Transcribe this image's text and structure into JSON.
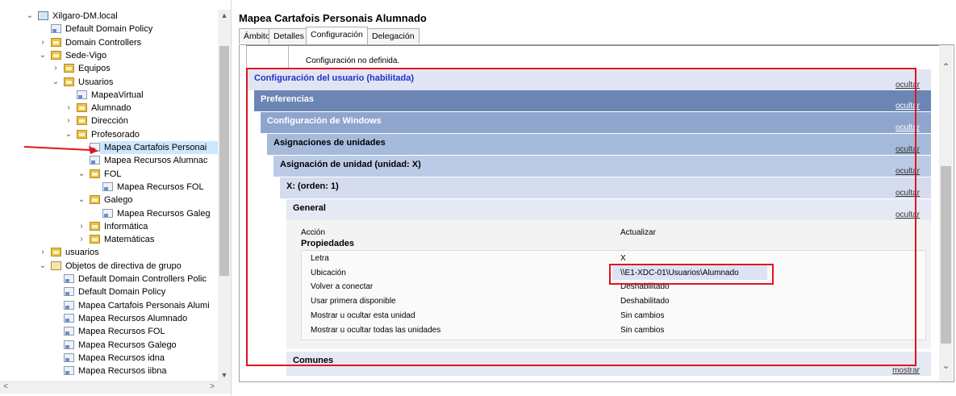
{
  "tree": {
    "items": [
      {
        "label": "Xilgaro-DM.local",
        "icon": "domain",
        "toggle": "expanded"
      },
      {
        "label": "Default Domain Policy",
        "icon": "gpo",
        "toggle": "none"
      },
      {
        "label": "Domain Controllers",
        "icon": "folder",
        "toggle": "collapsed"
      },
      {
        "label": "Sede-Vigo",
        "icon": "folder",
        "toggle": "expanded"
      },
      {
        "label": "Equipos",
        "icon": "folder",
        "toggle": "collapsed"
      },
      {
        "label": "Usuarios",
        "icon": "folder",
        "toggle": "expanded"
      },
      {
        "label": "MapeaVirtual",
        "icon": "gpo",
        "toggle": "none"
      },
      {
        "label": "Alumnado",
        "icon": "folder",
        "toggle": "collapsed"
      },
      {
        "label": "Dirección",
        "icon": "folder",
        "toggle": "collapsed"
      },
      {
        "label": "Profesorado",
        "icon": "folder",
        "toggle": "expanded"
      },
      {
        "label": "Mapea Cartafois Personai",
        "icon": "gpo",
        "toggle": "none",
        "selected": true
      },
      {
        "label": "Mapea Recursos Alumnac",
        "icon": "gpo",
        "toggle": "none"
      },
      {
        "label": "FOL",
        "icon": "folder",
        "toggle": "expanded"
      },
      {
        "label": "Mapea Recursos FOL",
        "icon": "gpo",
        "toggle": "none"
      },
      {
        "label": "Galego",
        "icon": "folder",
        "toggle": "expanded"
      },
      {
        "label": "Mapea Recursos Galeg",
        "icon": "gpo",
        "toggle": "none"
      },
      {
        "label": "Informática",
        "icon": "folder",
        "toggle": "collapsed"
      },
      {
        "label": "Matemáticas",
        "icon": "folder",
        "toggle": "collapsed"
      },
      {
        "label": "usuarios",
        "icon": "folder",
        "toggle": "collapsed"
      },
      {
        "label": "Objetos de directiva de grupo",
        "icon": "gpofolder",
        "toggle": "expanded"
      },
      {
        "label": "Default Domain Controllers Polic",
        "icon": "gpo",
        "toggle": "none"
      },
      {
        "label": "Default Domain Policy",
        "icon": "gpo",
        "toggle": "none"
      },
      {
        "label": "Mapea Cartafois Personais Alumi",
        "icon": "gpo",
        "toggle": "none"
      },
      {
        "label": "Mapea Recursos Alumnado",
        "icon": "gpo",
        "toggle": "none"
      },
      {
        "label": "Mapea Recursos FOL",
        "icon": "gpo",
        "toggle": "none"
      },
      {
        "label": "Mapea Recursos Galego",
        "icon": "gpo",
        "toggle": "none"
      },
      {
        "label": "Mapea Recursos idna",
        "icon": "gpo",
        "toggle": "none"
      },
      {
        "label": "Mapea Recursos iibna",
        "icon": "gpo",
        "toggle": "none"
      }
    ]
  },
  "main": {
    "title": "Mapea Cartafois Personais Alumnado",
    "tabs": [
      "Ámbito",
      "Detalles",
      "Configuración",
      "Delegación"
    ],
    "active_tab": "Configuración",
    "report": {
      "top_text": "Configuración no definida.",
      "headers": [
        {
          "label": "Configuración del usuario (habilitada)",
          "action": "ocultar"
        },
        {
          "label": "Preferencias",
          "action": "ocultar"
        },
        {
          "label": "Configuración de Windows",
          "action": "ocultar"
        },
        {
          "label": "Asignaciones de unidades",
          "action": "ocultar"
        },
        {
          "label": "Asignación de unidad (unidad: X)",
          "action": "ocultar"
        },
        {
          "label": "X: (orden: 1)",
          "action": "ocultar"
        },
        {
          "label": "General",
          "action": "ocultar"
        }
      ],
      "action_label": "Acción",
      "action_value": "Actualizar",
      "props_title": "Propiedades",
      "properties": [
        {
          "name": "Letra",
          "value": "X"
        },
        {
          "name": "Ubicación",
          "value": "\\\\E1-XDC-01\\Usuarios\\Alumnado"
        },
        {
          "name": "Volver a conectar",
          "value": "Deshabilitado"
        },
        {
          "name": "Usar primera disponible",
          "value": "Deshabilitado"
        },
        {
          "name": "Mostrar u ocultar esta unidad",
          "value": "Sin cambios"
        },
        {
          "name": "Mostrar u ocultar todas las unidades",
          "value": "Sin cambios"
        }
      ],
      "footer": {
        "label": "Comunes",
        "action": "mostrar"
      }
    }
  },
  "colors": {
    "header_bg": [
      "#e1e5f3",
      "#6b86b5",
      "#8ea6ce",
      "#a6bbdc",
      "#bccbe5",
      "#d4dcee",
      "#e5e9f4"
    ],
    "annotation": "#e0141e",
    "selection": "#cce8ff"
  }
}
